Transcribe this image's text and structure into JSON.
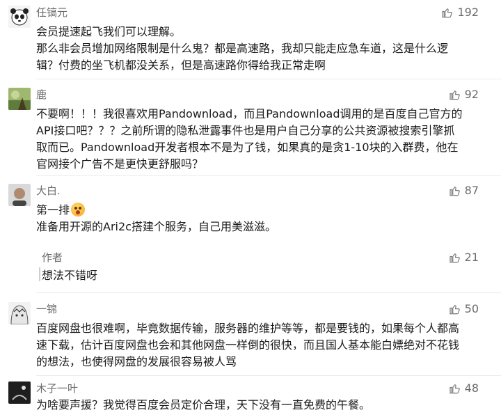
{
  "comments": [
    {
      "author": "任镐元",
      "likes": "192",
      "lines": [
        "会员提速起飞我们可以理解。",
        "那么非会员增加网络限制是什么鬼？都是高速路，我却只能走应急车道，这是什么逻",
        "辑？付费的坐飞机都没关系，但是高速路你得给我正常走啊"
      ]
    },
    {
      "author": "鹿",
      "likes": "92",
      "lines": [
        "不要啊！！！我很喜欢用Pandownload，而且Pandownload调用的是百度自己官方的",
        "API接口吧？？？之前所谓的隐私泄露事件也是用户自己分享的公共资源被搜索引擎抓",
        "取而已。Pandownload开发者根本不是为了钱，如果真的是贪1-10块的入群费，他在",
        "官网接个广告不是更快更舒服吗？"
      ]
    },
    {
      "author": "大白.",
      "likes": "87",
      "lines": [
        "第一排",
        "准备用开源的Ari2c搭建个服务，自己用美滋滋。"
      ],
      "reply": {
        "author": "作者",
        "likes": "21",
        "text": "想法不错呀"
      }
    },
    {
      "author": "一锦",
      "likes": "50",
      "lines": [
        "百度网盘也很难啊，毕竟数据传输，服务器的维护等等，都是要钱的，如果每个人都高",
        "速下载，估计百度网盘也会和其他网盘一样倒的很快，而且国人基本能白嫖绝对不花钱",
        "的想法，也使得网盘的发展很容易被人骂"
      ]
    },
    {
      "author": "木子一叶",
      "likes": "48",
      "lines": [
        "为啥要声援？我觉得百度会员定价合理，天下没有一直免费的午餐。"
      ]
    }
  ]
}
